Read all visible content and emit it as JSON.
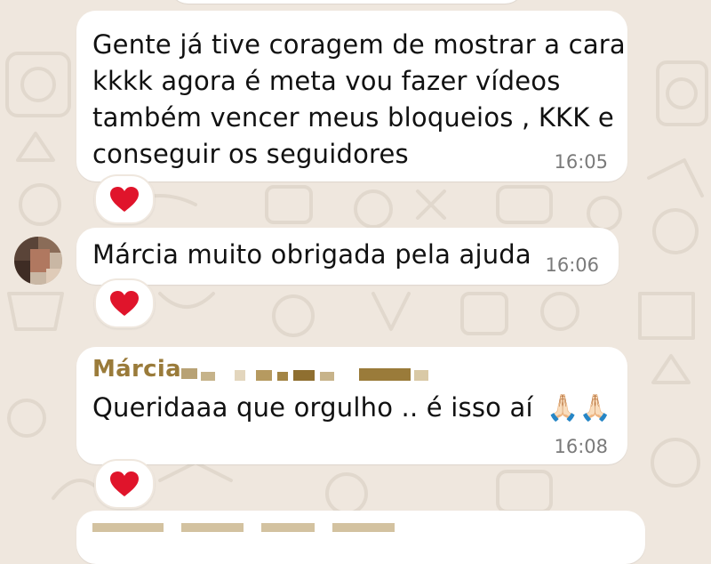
{
  "colors": {
    "wallpaper": "#efe7de",
    "bubble": "#ffffff",
    "sender_name": "#9a7b3a",
    "timestamp": "#7a7a7a",
    "heart": "#e0142b"
  },
  "messages": [
    {
      "lines": [
        "Gente já tive coragem de mostrar a cara",
        "kkkk agora é meta vou fazer vídeos",
        "também vencer meus bloqueios , KKK e",
        "conseguir os seguidores"
      ],
      "time": "16:05",
      "reaction_icon": "red-heart-icon"
    },
    {
      "text": "Márcia muito obrigada pela ajuda",
      "time": "16:06",
      "reaction_icon": "red-heart-icon"
    },
    {
      "sender": "Márcia",
      "text": "Queridaaa que orgulho .. é isso aí",
      "emoji": "🙏🏻🙏🏻",
      "time": "16:08",
      "reaction_icon": "red-heart-icon"
    }
  ]
}
